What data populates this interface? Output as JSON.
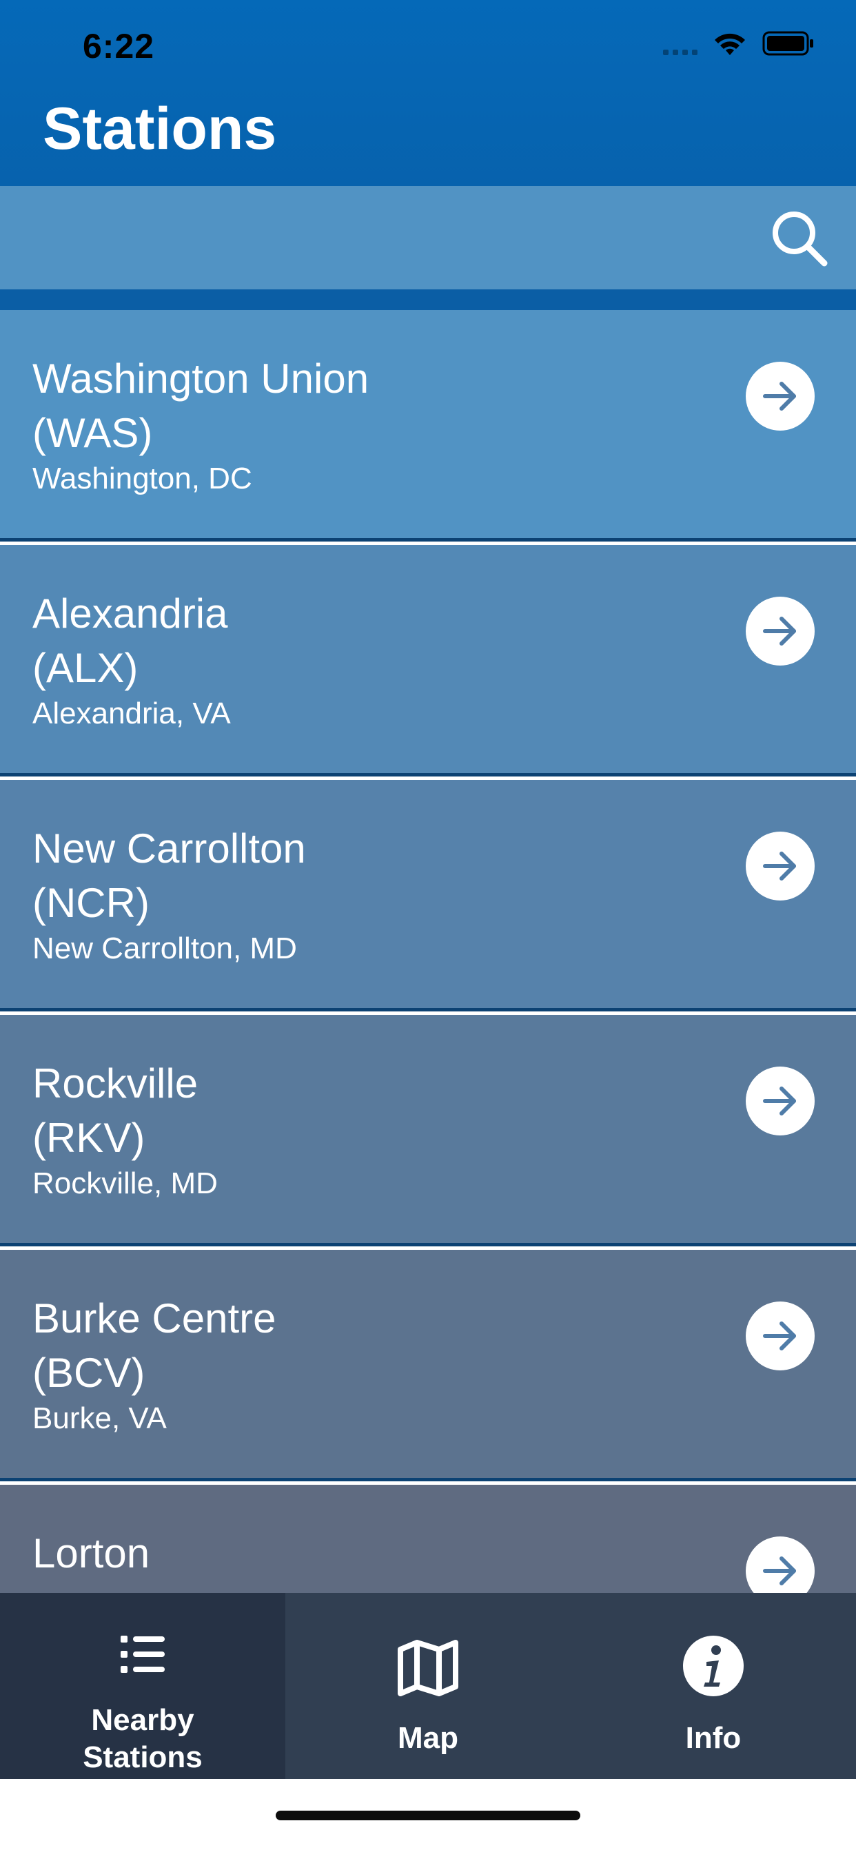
{
  "status_bar": {
    "time": "6:22"
  },
  "header": {
    "title": "Stations"
  },
  "search": {
    "placeholder": "",
    "value": ""
  },
  "stations": [
    {
      "name": "Washington Union",
      "code": "(WAS)",
      "location": "Washington, DC"
    },
    {
      "name": "Alexandria",
      "code": "(ALX)",
      "location": "Alexandria, VA"
    },
    {
      "name": "New Carrollton",
      "code": "(NCR)",
      "location": "New Carrollton, MD"
    },
    {
      "name": "Rockville",
      "code": "(RKV)",
      "location": "Rockville, MD"
    },
    {
      "name": "Burke Centre",
      "code": "(BCV)",
      "location": "Burke, VA"
    },
    {
      "name": "Lorton",
      "code": "",
      "location": ""
    }
  ],
  "tabs": [
    {
      "label": "Nearby\nStations",
      "icon": "list-icon",
      "active": true
    },
    {
      "label": "Map",
      "icon": "map-icon",
      "active": false
    },
    {
      "label": "Info",
      "icon": "info-icon",
      "active": false
    }
  ],
  "colors": {
    "header_bg": "#0569b8",
    "search_bg": "#5193c4",
    "tab_bar_bg": "#313f52",
    "tab_active_bg": "#263245",
    "row_top": "#5193c4",
    "row_bottom": "#5f6b7f"
  }
}
